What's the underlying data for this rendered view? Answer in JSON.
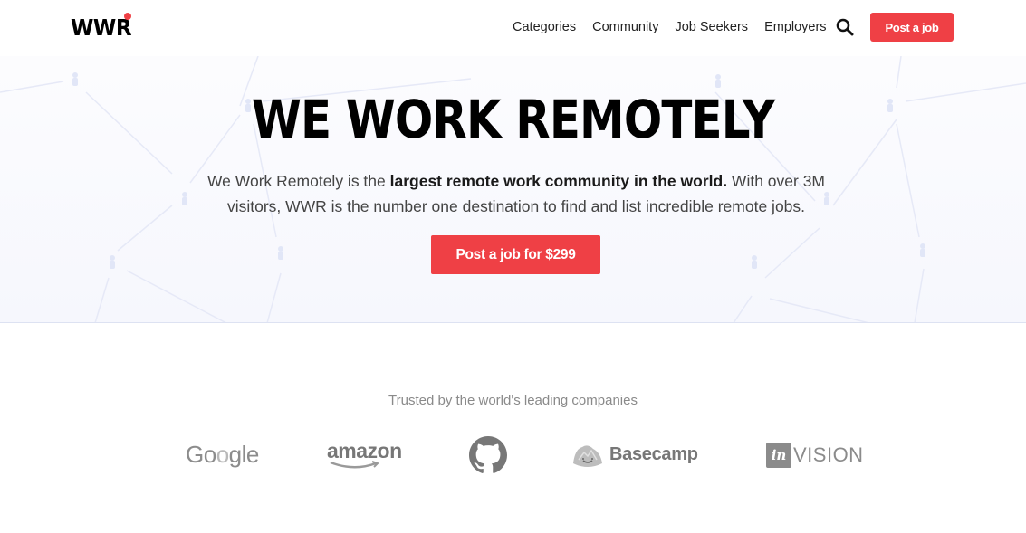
{
  "header": {
    "logo_text": "WWR",
    "nav": [
      {
        "label": "Categories"
      },
      {
        "label": "Community"
      },
      {
        "label": "Job Seekers"
      },
      {
        "label": "Employers"
      }
    ],
    "search_icon": "search-icon",
    "post_job_label": "Post a job"
  },
  "hero": {
    "headline": "WE WORK REMOTELY",
    "subtext_prefix": "We Work Remotely is the ",
    "subtext_bold": "largest remote work community in the world.",
    "subtext_suffix": " With over 3M visitors, WWR is the number one destination to find and list incredible remote jobs.",
    "cta_label": "Post a job for $299"
  },
  "trusted": {
    "heading": "Trusted by the world's leading companies",
    "companies": [
      {
        "name": "Google"
      },
      {
        "name": "amazon"
      },
      {
        "name": "GitHub",
        "icon": "github-icon"
      },
      {
        "name": "Basecamp"
      },
      {
        "name": "InVision",
        "box_text": "in",
        "text": "VISION"
      }
    ]
  },
  "colors": {
    "accent": "#ef4045",
    "hero_bg": "#f6f7fd",
    "logo_gray": "#7b7b7b"
  }
}
